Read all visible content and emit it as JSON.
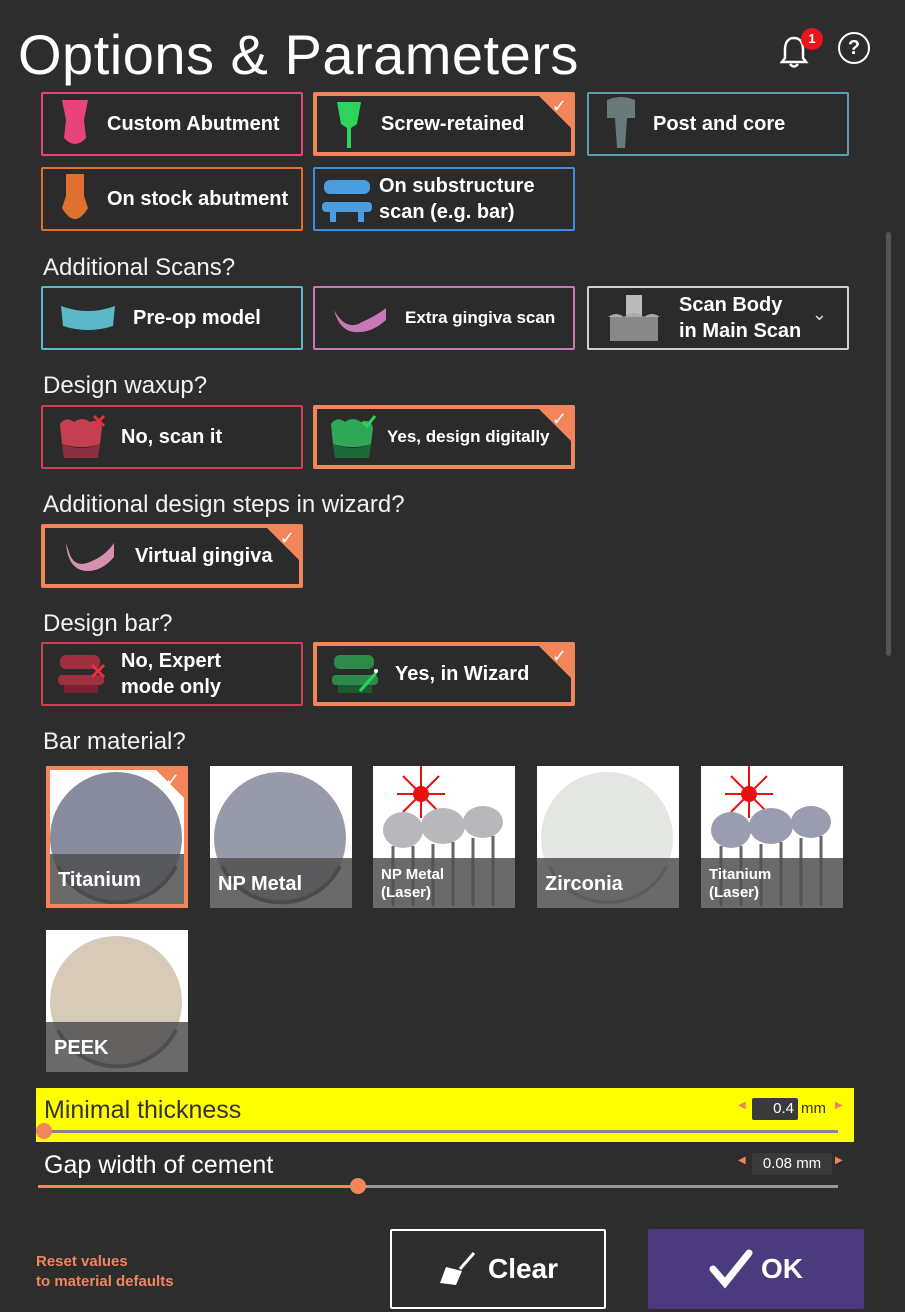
{
  "header": {
    "title": "Options & Parameters",
    "notification_count": "1",
    "help_label": "?"
  },
  "colors": {
    "accent": "#f3855a",
    "highlight": "#ffff00",
    "ok_bg": "#4c3a7e"
  },
  "restoration_types": [
    {
      "label": "Custom Abutment",
      "color": "#e8437a",
      "selected": false,
      "icon": "custom-abutment-icon"
    },
    {
      "label": "Screw-retained",
      "color": "#f3855a",
      "selected": true,
      "icon": "screw-retained-icon"
    },
    {
      "label": "Post and core",
      "color": "#5a9eae",
      "selected": false,
      "icon": "post-core-icon"
    },
    {
      "label": "On stock abutment",
      "color": "#e07030",
      "selected": false,
      "icon": "stock-abutment-icon"
    },
    {
      "label_line1": "On substructure",
      "label_line2": "scan (e.g. bar)",
      "color": "#3a8fd8",
      "selected": false,
      "icon": "substructure-icon"
    }
  ],
  "additional_scans": {
    "label": "Additional Scans?",
    "options": [
      {
        "label": "Pre-op model",
        "color": "#5ab8c8",
        "icon": "preop-model-icon"
      },
      {
        "label": "Extra gingiva scan",
        "color": "#c878b8",
        "icon": "gingiva-scan-icon"
      },
      {
        "label_line1": "Scan Body",
        "label_line2": "in Main Scan",
        "color": "#d0d0d0",
        "icon": "scan-body-icon"
      }
    ]
  },
  "design_waxup": {
    "label": "Design waxup?",
    "options": [
      {
        "label": "No, scan it",
        "color": "#d04050",
        "selected": false
      },
      {
        "label": "Yes, design digitally",
        "color": "#f3855a",
        "selected": true
      }
    ]
  },
  "additional_steps": {
    "label": "Additional design steps in wizard?",
    "options": [
      {
        "label": "Virtual gingiva",
        "selected": true
      }
    ]
  },
  "design_bar": {
    "label": "Design bar?",
    "options": [
      {
        "label_line1": "No, Expert",
        "label_line2": "mode only",
        "color": "#d04050",
        "selected": false
      },
      {
        "label": "Yes, in Wizard",
        "color": "#f3855a",
        "selected": true
      }
    ]
  },
  "bar_material": {
    "label": "Bar material?",
    "items": [
      {
        "label": "Titanium",
        "selected": true
      },
      {
        "label": "NP Metal",
        "selected": false
      },
      {
        "label_line1": "NP Metal",
        "label_line2": "(Laser)",
        "selected": false
      },
      {
        "label": "Zirconia",
        "selected": false
      },
      {
        "label_line1": "Titanium",
        "label_line2": "(Laser)",
        "selected": false
      },
      {
        "label": "PEEK",
        "selected": false
      }
    ]
  },
  "sliders": {
    "min_thickness": {
      "label": "Minimal thickness",
      "value": "0.4",
      "unit": "mm",
      "fraction": 0.0
    },
    "gap_width": {
      "label": "Gap width of cement",
      "value": "0.08",
      "unit": "mm",
      "fraction": 0.4
    }
  },
  "footer": {
    "reset_line1": "Reset values",
    "reset_line2": "to material defaults",
    "clear_label": "Clear",
    "ok_label": "OK"
  }
}
